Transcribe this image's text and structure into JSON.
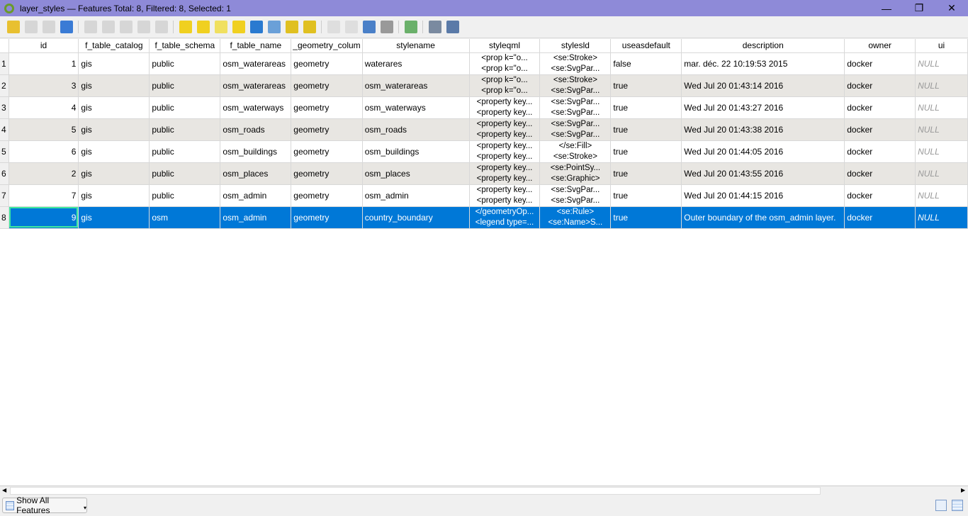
{
  "window": {
    "title": "layer_styles — Features Total: 8, Filtered: 8, Selected: 1"
  },
  "toolbar": {
    "icons": [
      "toggle-editing",
      "multi-edit",
      "save-edits",
      "reload",
      "add-feature",
      "delete-selected",
      "cut",
      "copy",
      "paste",
      "expression-select",
      "select-all",
      "invert-selection",
      "deselect-all",
      "filter-select",
      "move-selection-top",
      "pan-to-selected",
      "zoom-to-selected",
      "new-field",
      "delete-field",
      "field-calculator",
      "open-calculator",
      "conditional-formatting",
      "dock-table",
      "actions"
    ]
  },
  "table": {
    "columns": [
      "id",
      "f_table_catalog",
      "f_table_schema",
      "f_table_name",
      "f_geometry_column",
      "stylename",
      "styleqml",
      "stylesld",
      "useasdefault",
      "description",
      "owner",
      "ui"
    ],
    "column_display": [
      "id",
      "f_table_catalog",
      "f_table_schema",
      "f_table_name",
      "_geometry_colum",
      "stylename",
      "styleqml",
      "stylesld",
      "useasdefault",
      "description",
      "owner",
      "ui"
    ],
    "rows": [
      {
        "n": "1",
        "id": "1",
        "catalog": "gis",
        "schema": "public",
        "name": "osm_waterareas",
        "geom": "geometry",
        "stylename": "waterares",
        "qml": [
          "<prop k=\"o...",
          "<prop k=\"o..."
        ],
        "sld": [
          "<se:Stroke>",
          "<se:SvgPar..."
        ],
        "default": "false",
        "desc": "mar. déc. 22 10:19:53 2015",
        "owner": "docker",
        "ui": "NULL"
      },
      {
        "n": "2",
        "id": "3",
        "catalog": "gis",
        "schema": "public",
        "name": "osm_waterareas",
        "geom": "geometry",
        "stylename": "osm_waterareas",
        "qml": [
          "<prop k=\"o...",
          "<prop k=\"o..."
        ],
        "sld": [
          "<se:Stroke>",
          "<se:SvgPar..."
        ],
        "default": "true",
        "desc": "Wed Jul 20 01:43:14 2016",
        "owner": "docker",
        "ui": "NULL"
      },
      {
        "n": "3",
        "id": "4",
        "catalog": "gis",
        "schema": "public",
        "name": "osm_waterways",
        "geom": "geometry",
        "stylename": "osm_waterways",
        "qml": [
          "<property key...",
          "<property key..."
        ],
        "sld": [
          "<se:SvgPar...",
          "<se:SvgPar..."
        ],
        "default": "true",
        "desc": "Wed Jul 20 01:43:27 2016",
        "owner": "docker",
        "ui": "NULL"
      },
      {
        "n": "4",
        "id": "5",
        "catalog": "gis",
        "schema": "public",
        "name": "osm_roads",
        "geom": "geometry",
        "stylename": "osm_roads",
        "qml": [
          "<property key...",
          "<property key..."
        ],
        "sld": [
          "<se:SvgPar...",
          "<se:SvgPar..."
        ],
        "default": "true",
        "desc": "Wed Jul 20 01:43:38 2016",
        "owner": "docker",
        "ui": "NULL"
      },
      {
        "n": "5",
        "id": "6",
        "catalog": "gis",
        "schema": "public",
        "name": "osm_buildings",
        "geom": "geometry",
        "stylename": "osm_buildings",
        "qml": [
          "<property key...",
          "<property key..."
        ],
        "sld": [
          "</se:Fill>",
          "<se:Stroke>"
        ],
        "default": "true",
        "desc": "Wed Jul 20 01:44:05 2016",
        "owner": "docker",
        "ui": "NULL"
      },
      {
        "n": "6",
        "id": "2",
        "catalog": "gis",
        "schema": "public",
        "name": "osm_places",
        "geom": "geometry",
        "stylename": "osm_places",
        "qml": [
          "<property key...",
          "<property key..."
        ],
        "sld": [
          "<se:PointSy...",
          "<se:Graphic>"
        ],
        "default": "true",
        "desc": "Wed Jul 20 01:43:55 2016",
        "owner": "docker",
        "ui": "NULL"
      },
      {
        "n": "7",
        "id": "7",
        "catalog": "gis",
        "schema": "public",
        "name": "osm_admin",
        "geom": "geometry",
        "stylename": "osm_admin",
        "qml": [
          "<property key...",
          "<property key..."
        ],
        "sld": [
          "<se:SvgPar...",
          "<se:SvgPar..."
        ],
        "default": "true",
        "desc": "Wed Jul 20 01:44:15 2016",
        "owner": "docker",
        "ui": "NULL"
      },
      {
        "n": "8",
        "id": "9",
        "catalog": "gis",
        "schema": "osm",
        "name": "osm_admin",
        "geom": "geometry",
        "stylename": "country_boundary",
        "qml": [
          "</geometryOp...",
          "<legend type=..."
        ],
        "sld": [
          "<se:Rule>",
          "<se:Name>S..."
        ],
        "default": "true",
        "desc": "Outer boundary of the osm_admin layer.",
        "owner": "docker",
        "ui": "NULL"
      }
    ],
    "selected_row": 8
  },
  "bottom": {
    "filter_button": "Show All Features"
  },
  "colors": {
    "titlebar": "#8e8ad8",
    "selection": "#0078d7",
    "alt_row": "#e8e6e2"
  }
}
